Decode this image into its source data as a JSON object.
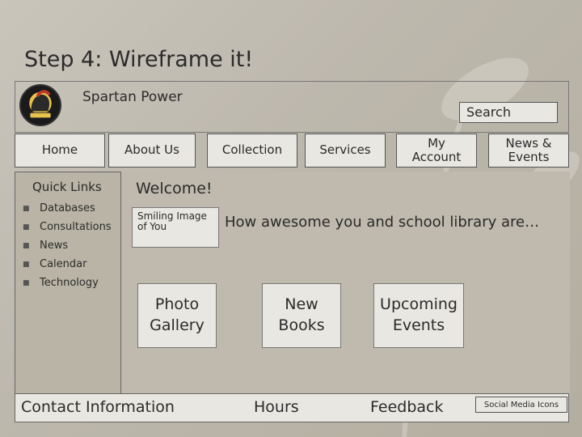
{
  "slide": {
    "title": "Step 4: Wireframe it!"
  },
  "header": {
    "site_name": "Spartan Power",
    "logo_icon": "spartan-helmet-icon",
    "search_label": "Search"
  },
  "nav": {
    "items": [
      {
        "label": "Home"
      },
      {
        "label": "About Us"
      },
      {
        "label": "Collection"
      },
      {
        "label": "Services"
      },
      {
        "label": "My\nAccount"
      },
      {
        "label": "News &\nEvents"
      }
    ]
  },
  "sidebar": {
    "title": "Quick Links",
    "items": [
      {
        "label": "Databases"
      },
      {
        "label": "Consultations"
      },
      {
        "label": "News"
      },
      {
        "label": "Calendar"
      },
      {
        "label": "Technology"
      }
    ]
  },
  "main": {
    "welcome": "Welcome!",
    "image_placeholder": "Smiling Image of You",
    "tagline": "How awesome you and school library are…",
    "tiles": [
      {
        "label": "Photo\nGallery"
      },
      {
        "label": "New\nBooks"
      },
      {
        "label": "Upcoming\nEvents"
      }
    ]
  },
  "footer": {
    "contact": "Contact Information",
    "hours": "Hours",
    "feedback": "Feedback",
    "social": "Social Media Icons"
  },
  "colors": {
    "background": "#c2bdb2",
    "box_fill": "#e9e7e2",
    "sidebar_fill": "#b9b4a5"
  }
}
